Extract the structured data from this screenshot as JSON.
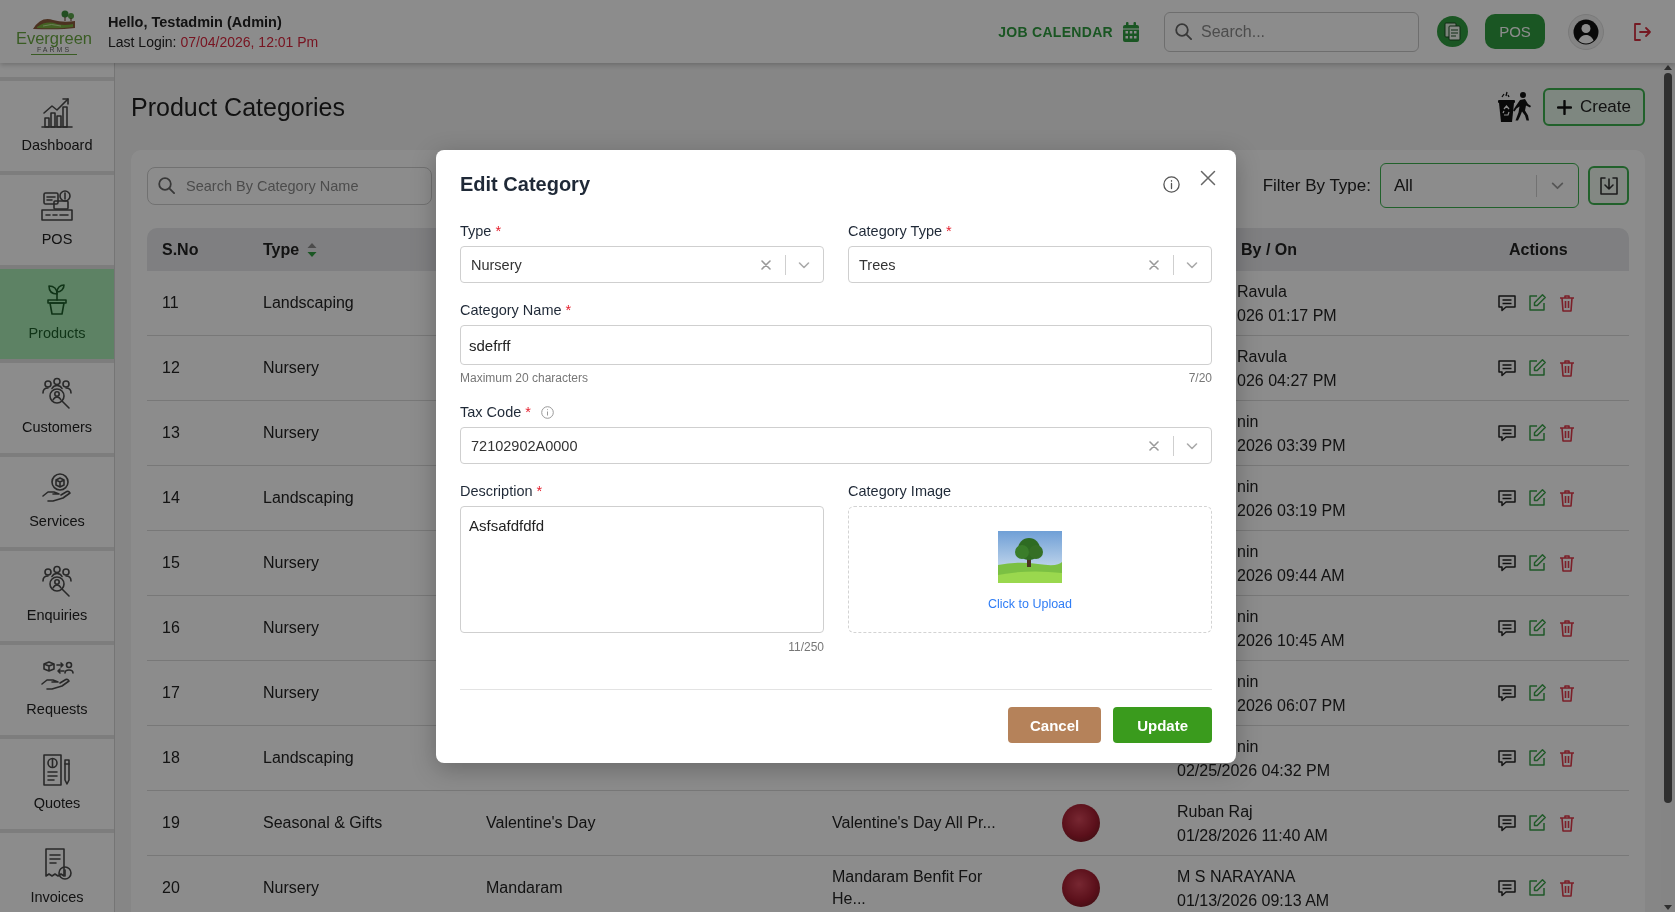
{
  "header": {
    "logo": {
      "name": "Evergreen",
      "tagline": "FARMS"
    },
    "greeting": "Hello, Testadmin (Admin)",
    "last_login": {
      "label": "Last Login:",
      "value": "07/04/2026, 12:01 Pm"
    },
    "job_calendar": "JOB CALENDAR",
    "search": {
      "placeholder": "Search..."
    },
    "pos_button": "POS"
  },
  "sidebar": {
    "items": [
      {
        "label": "Dashboard",
        "selected": false
      },
      {
        "label": "POS",
        "selected": false
      },
      {
        "label": "Products",
        "selected": true
      },
      {
        "label": "Customers",
        "selected": false
      },
      {
        "label": "Services",
        "selected": false
      },
      {
        "label": "Enquiries",
        "selected": false
      },
      {
        "label": "Requests",
        "selected": false
      },
      {
        "label": "Quotes",
        "selected": false
      },
      {
        "label": "Invoices",
        "selected": false
      }
    ]
  },
  "page": {
    "title": "Product Categories",
    "create_button": "Create"
  },
  "filters": {
    "search": {
      "placeholder": "Search By Category Name"
    },
    "filter_label": "Filter By Type:",
    "filter_value": "All"
  },
  "table": {
    "columns": [
      {
        "label": "S.No"
      },
      {
        "label": "Type",
        "sortable": true,
        "descending": true
      },
      {
        "label": "By / On"
      },
      {
        "label": "Actions"
      }
    ],
    "rows": [
      {
        "sno": "11",
        "type": "Landscaping",
        "created_by": "Ravula",
        "created_on": "026 01:17 PM"
      },
      {
        "sno": "12",
        "type": "Nursery",
        "created_by": "Ravula",
        "created_on": "026 04:27 PM"
      },
      {
        "sno": "13",
        "type": "Nursery",
        "created_by": "nin",
        "created_on": "2026 03:39 PM"
      },
      {
        "sno": "14",
        "type": "Landscaping",
        "created_by": "nin",
        "created_on": "2026 03:19 PM"
      },
      {
        "sno": "15",
        "type": "Nursery",
        "created_by": "nin",
        "created_on": "2026 09:44 AM"
      },
      {
        "sno": "16",
        "type": "Nursery",
        "created_by": "nin",
        "created_on": "2026 10:45 AM"
      },
      {
        "sno": "17",
        "type": "Nursery",
        "created_by": "nin",
        "created_on": "2026 06:07 PM"
      },
      {
        "sno": "18",
        "type": "Landscaping",
        "created_by": "nin",
        "created_on": "02/25/2026 04:32 PM"
      },
      {
        "sno": "19",
        "type": "Seasonal & Gifts",
        "name": "Valentine's Day",
        "description": "Valentine's Day All Pr...",
        "thumbnail": true,
        "created_by": "Ruban Raj",
        "created_on": "01/28/2026 11:40 AM"
      },
      {
        "sno": "20",
        "type": "Nursery",
        "name": "Mandaram",
        "description": "Mandaram Benfit For He...",
        "thumbnail": true,
        "created_by": "M S NARAYANA",
        "created_on": "01/13/2026 09:13 AM"
      }
    ]
  },
  "dialog": {
    "title": "Edit Category",
    "rows": [
      [
        {
          "kind": "select",
          "label": "Type",
          "mark": "*",
          "value": "Nursery"
        },
        {
          "kind": "select",
          "label": "Category Type",
          "mark": "*",
          "value": "Trees"
        }
      ],
      [
        {
          "kind": "text",
          "label": "Category Name",
          "mark": "*",
          "value": "sdefrff",
          "hint": "Maximum 20 characters",
          "counter": "7/20"
        }
      ],
      [
        {
          "kind": "select",
          "label": "Tax Code",
          "mark": "*",
          "info": true,
          "value": "72102902A0000"
        }
      ],
      [
        {
          "kind": "textarea",
          "label": "Description",
          "mark": "*",
          "value": "Asfsafdfdfd",
          "counter": "11/250"
        },
        {
          "kind": "upload",
          "label": "Category Image",
          "link": "Click to Upload"
        }
      ]
    ],
    "buttons": [
      {
        "kind": "cancel",
        "label": "Cancel"
      },
      {
        "kind": "submit",
        "label": "Update"
      }
    ]
  }
}
